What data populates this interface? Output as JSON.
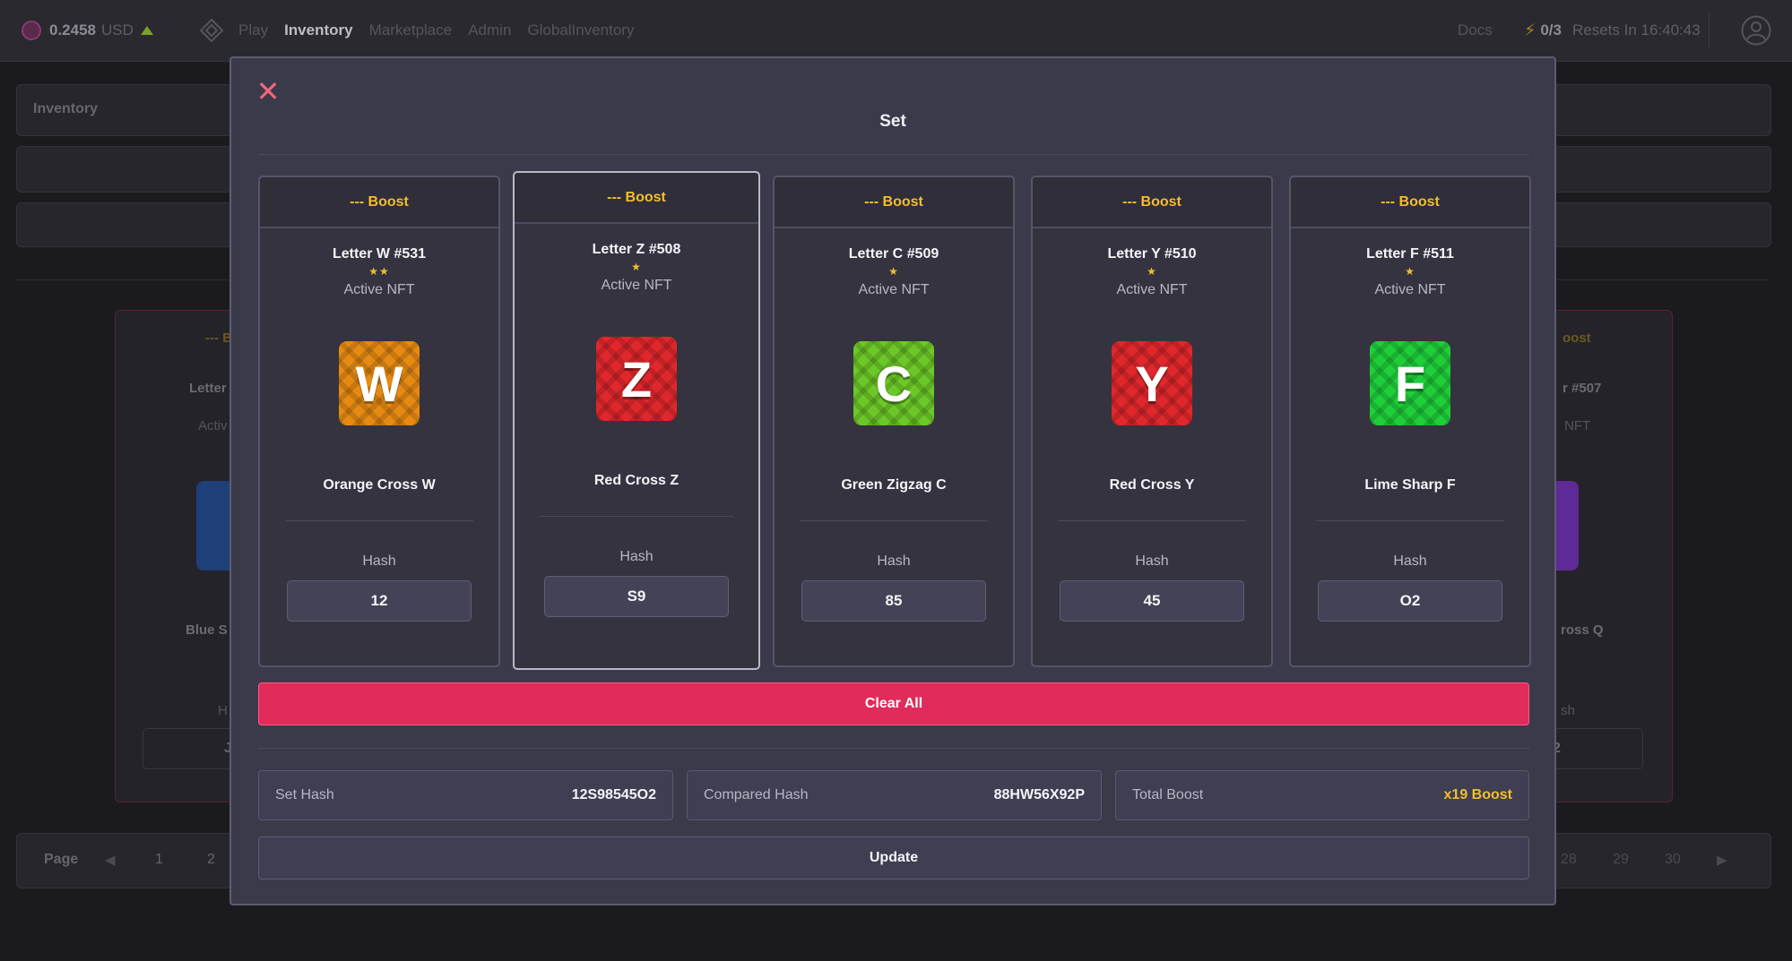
{
  "topbar": {
    "balance": "0.2458",
    "currency": "USD",
    "nav": [
      "Play",
      "Inventory",
      "Marketplace",
      "Admin",
      "GlobalInventory"
    ],
    "active_nav": "Inventory",
    "docs": "Docs",
    "energy": "0/3",
    "resets": "Resets In 16:40:43"
  },
  "background": {
    "inventory_label": "Inventory",
    "page_label": "Page",
    "pages_left": [
      "1",
      "2"
    ],
    "pages_right": [
      "28",
      "29",
      "30"
    ],
    "left_card": {
      "boost": "--- B",
      "name": "Letter",
      "active": "Activ",
      "title": "Blue S",
      "hash_label": "H",
      "hash_value": "J"
    },
    "right_card": {
      "boost": "oost",
      "name": "r #507",
      "active": "NFT",
      "title": "ross Q",
      "hash_label": "sh",
      "hash_value": "2"
    }
  },
  "modal": {
    "title": "Set",
    "close_icon": "close-icon",
    "cards": [
      {
        "boost": "--- Boost",
        "name": "Letter W #531",
        "stars": "★★",
        "active": "Active NFT",
        "letter": "W",
        "title": "Orange Cross W",
        "hash_label": "Hash",
        "hash": "12",
        "color": "#e68a12",
        "dark": "#b5650a",
        "selected": false
      },
      {
        "boost": "--- Boost",
        "name": "Letter Z #508",
        "stars": "★",
        "active": "Active NFT",
        "letter": "Z",
        "title": "Red Cross Z",
        "hash_label": "Hash",
        "hash": "S9",
        "color": "#e0272c",
        "dark": "#a8161b",
        "selected": true
      },
      {
        "boost": "--- Boost",
        "name": "Letter C #509",
        "stars": "★",
        "active": "Active NFT",
        "letter": "C",
        "title": "Green Zigzag C",
        "hash_label": "Hash",
        "hash": "85",
        "color": "#6cc828",
        "dark": "#4a9418",
        "selected": false
      },
      {
        "boost": "--- Boost",
        "name": "Letter Y #510",
        "stars": "★",
        "active": "Active NFT",
        "letter": "Y",
        "title": "Red Cross Y",
        "hash_label": "Hash",
        "hash": "45",
        "color": "#e0272c",
        "dark": "#a8161b",
        "selected": false
      },
      {
        "boost": "--- Boost",
        "name": "Letter F #511",
        "stars": "★",
        "active": "Active NFT",
        "letter": "F",
        "title": "Lime Sharp F",
        "hash_label": "Hash",
        "hash": "O2",
        "color": "#1fcf3a",
        "dark": "#139a27",
        "selected": false
      }
    ],
    "clear_label": "Clear All",
    "set_hash_label": "Set Hash",
    "set_hash": "12S98545O2",
    "compared_hash_label": "Compared Hash",
    "compared_hash": "88HW56X92P",
    "total_boost_label": "Total Boost",
    "total_boost": "x19 Boost",
    "update_label": "Update"
  }
}
